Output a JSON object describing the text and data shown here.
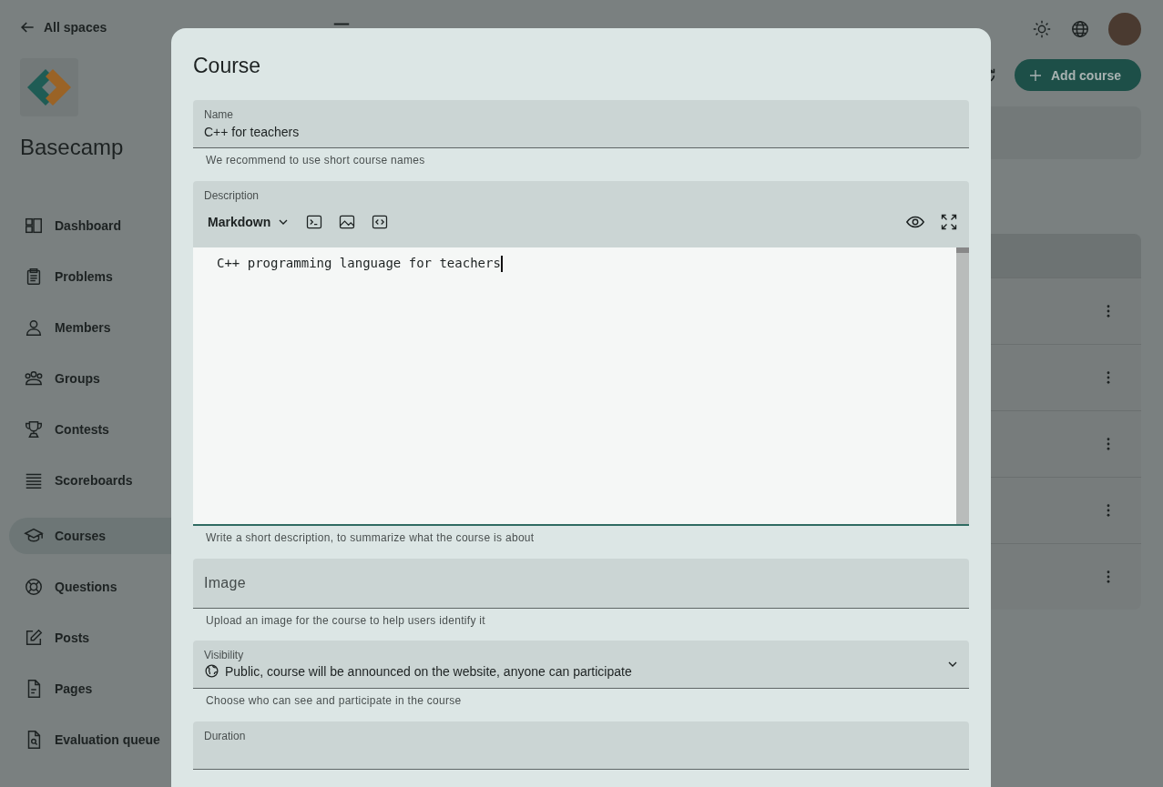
{
  "top_bar": {
    "back_label": "All spaces"
  },
  "space": {
    "name": "Basecamp"
  },
  "sidebar": {
    "items": [
      {
        "label": "Dashboard",
        "kind": "dashboard",
        "selected": false
      },
      {
        "label": "Problems",
        "kind": "clipboard",
        "selected": false
      },
      {
        "label": "Members",
        "kind": "person",
        "selected": false
      },
      {
        "label": "Groups",
        "kind": "group",
        "selected": false
      },
      {
        "label": "Contests",
        "kind": "trophy",
        "selected": false
      },
      {
        "label": "Scoreboards",
        "kind": "lines",
        "selected": false
      },
      {
        "label": "Courses",
        "kind": "cap",
        "selected": true
      },
      {
        "label": "Questions",
        "kind": "lifebuoy",
        "selected": false
      },
      {
        "label": "Posts",
        "kind": "pencil",
        "selected": false
      },
      {
        "label": "Pages",
        "kind": "page",
        "selected": false
      },
      {
        "label": "Evaluation queue",
        "kind": "search-page",
        "selected": false
      }
    ]
  },
  "page": {
    "add_button": "Add course"
  },
  "dialog": {
    "title": "Course",
    "name": {
      "label": "Name",
      "value": "C++ for teachers",
      "hint": "We recommend to use short course names"
    },
    "description": {
      "label": "Description",
      "mode": "Markdown",
      "value": "C++ programming language for teachers",
      "hint": "Write a short description, to summarize what the course is about"
    },
    "image": {
      "placeholder": "Image",
      "hint": "Upload an image for the course to help users identify it"
    },
    "visibility": {
      "label": "Visibility",
      "value": "Public, course will be announced on the website, anyone can participate",
      "hint": "Choose who can see and participate in the course"
    },
    "duration": {
      "label": "Duration"
    }
  }
}
